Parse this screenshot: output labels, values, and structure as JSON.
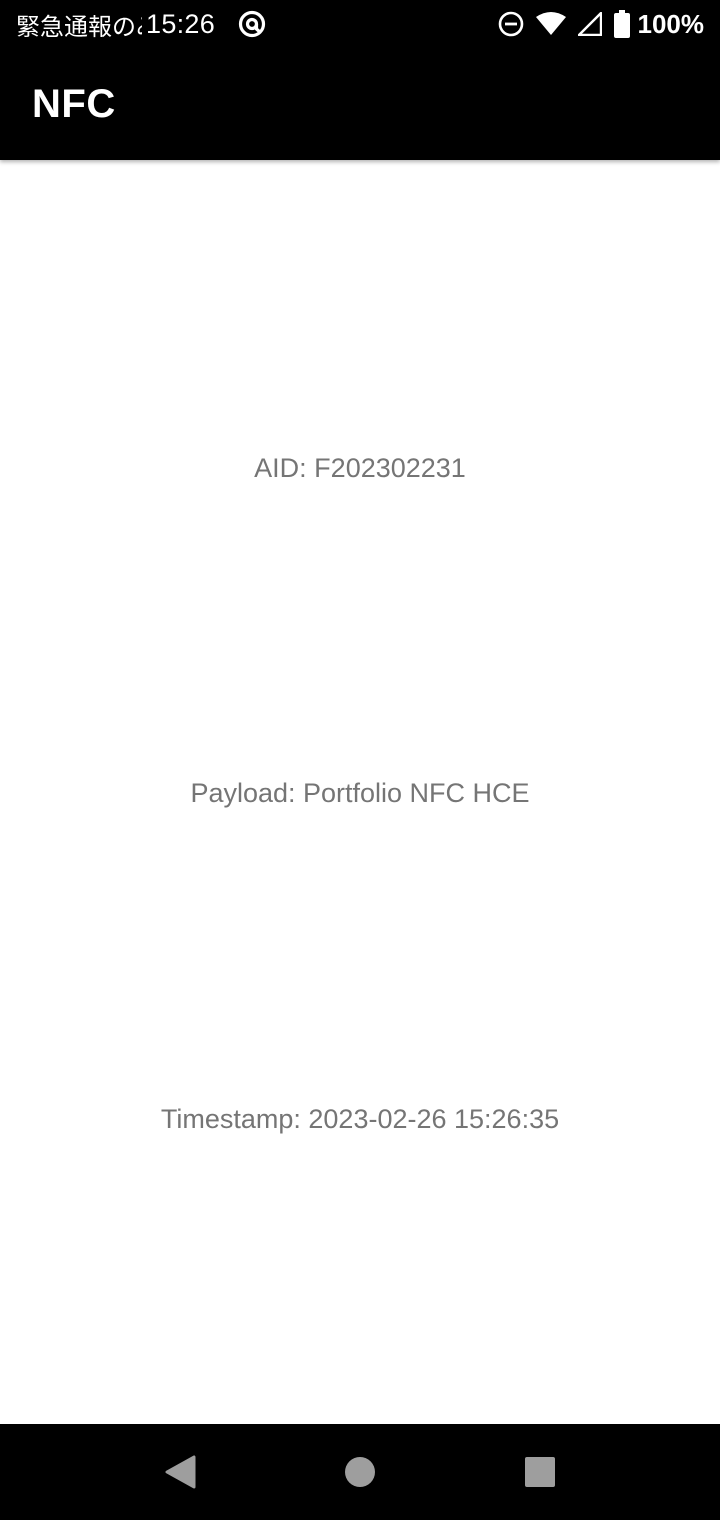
{
  "status_bar": {
    "carrier_text": "緊急通報のみ",
    "time": "15:26",
    "battery_percent": "100%",
    "icons": [
      "at-sign-icon",
      "do-not-disturb-icon",
      "wifi-icon",
      "cellular-signal-icon",
      "battery-icon"
    ]
  },
  "app_bar": {
    "title": "NFC"
  },
  "main": {
    "aid_text": "AID: F202302231",
    "payload_text": "Payload: Portfolio NFC HCE",
    "timestamp_text": "Timestamp: 2023-02-26 15:26:35"
  },
  "nav_bar": {
    "icons": [
      "back-icon",
      "home-icon",
      "recents-icon"
    ]
  },
  "colors": {
    "bars": "#000000",
    "background": "#ffffff",
    "body_text": "#757575",
    "nav_icons": "#9e9e9e"
  }
}
